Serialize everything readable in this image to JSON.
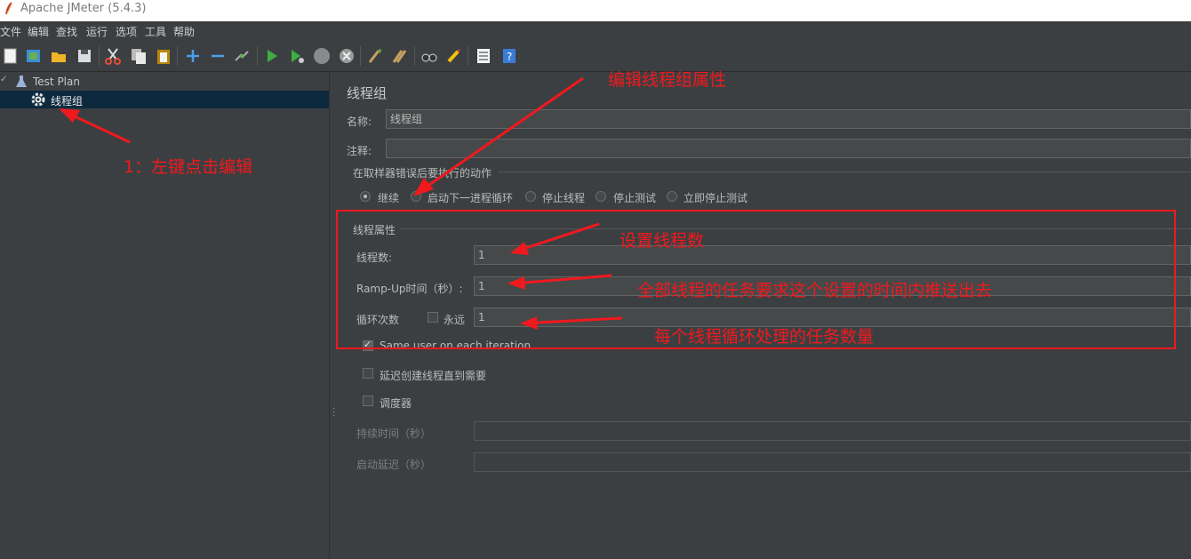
{
  "window": {
    "title": "Apache JMeter (5.4.3)"
  },
  "menu": [
    "文件",
    "编辑",
    "查找",
    "运行",
    "选项",
    "工具",
    "帮助"
  ],
  "tree": {
    "root": "Test Plan",
    "child": "线程组"
  },
  "panel": {
    "heading": "线程组",
    "name_label": "名称:",
    "name_value": "线程组",
    "comment_label": "注释:",
    "comment_value": "",
    "error_action_title": "在取样器错误后要执行的动作",
    "error_actions": [
      "继续",
      "启动下一进程循环",
      "停止线程",
      "停止测试",
      "立即停止测试"
    ],
    "selected_error_action": "继续",
    "thread_props_title": "线程属性",
    "threads_label": "线程数:",
    "threads_value": "1",
    "rampup_label": "Ramp-Up时间（秒）:",
    "rampup_value": "1",
    "loop_label": "循环次数",
    "forever_label": "永远",
    "forever_checked": false,
    "loop_value": "1",
    "same_user_label": "Same user on each iteration",
    "same_user_checked": true,
    "delay_label": "延迟创建线程直到需要",
    "delay_checked": false,
    "scheduler_label": "调度器",
    "scheduler_checked": false,
    "duration_label": "持续时间（秒）",
    "startup_delay_label": "启动延迟（秒）"
  },
  "annotations": {
    "left_click": "1：左键点击编辑",
    "edit_props": "编辑线程组属性",
    "set_threads": "设置线程数",
    "rampup_note": "全部线程的任务要求这个设置的时间内推送出去",
    "loop_note": "每个线程循环处理的任务数量"
  },
  "colors": {
    "annotation": "#f0191e",
    "background": "#3c3f41",
    "selection": "#0d293e"
  }
}
